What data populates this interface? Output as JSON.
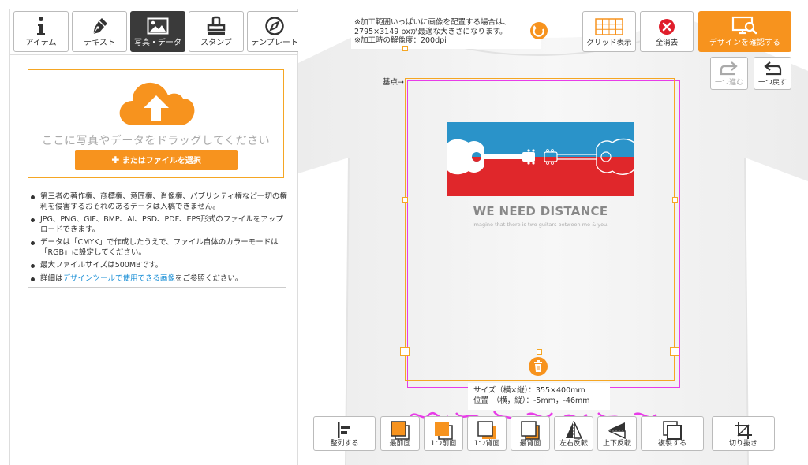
{
  "tabs": [
    {
      "label": "アイテム",
      "icon": "info-icon"
    },
    {
      "label": "テキスト",
      "icon": "pen-icon"
    },
    {
      "label": "写真・データ",
      "icon": "image-icon",
      "active": true
    },
    {
      "label": "スタンプ",
      "icon": "stamp-icon"
    },
    {
      "label": "テンプレート",
      "icon": "compass-icon"
    }
  ],
  "upload": {
    "drop_text": "ここに写真やデータをドラッグしてください",
    "select_button": "またはファイルを選択",
    "button_icon": "plus-icon"
  },
  "notes": [
    "第三者の著作権、商標権、意匠権、肖像権、パブリシティ権など一切の権利を侵害するおそれのあるデータは入稿できません。",
    "JPG、PNG、GIF、BMP、AI、PSD、PDF、EPS形式のファイルをアップロードできます。",
    "データは「CMYK」で作成したうえで、ファイル自体のカラーモードは「RGB」に設定してください。",
    "最大ファイルサイズは500MBです。"
  ],
  "note_last": {
    "prefix": "詳細は",
    "link": "デザインツールで使用できる画像",
    "suffix": "をご参照ください。"
  },
  "canvas": {
    "info_lines": [
      "※加工範囲いっぱいに画像を配置する場合は、",
      "2795×3149 pxが最適な大きさになります。",
      "※加工時の解像度：200dpi"
    ],
    "base_point_label": "基点→",
    "design_title": "WE NEED DISTANCE",
    "design_subtitle": "Imagine that there is two guitars between me & you.",
    "size_line": "サイズ（横×縦）：355×400mm",
    "position_line": "位置　（横，縦）：-5mm，-46mm",
    "colors": {
      "band_blue": "#2a93c9",
      "band_red": "#e0272b",
      "accent": "#f7931e",
      "print_area": "#e83ce8"
    }
  },
  "top_buttons": {
    "grid": "グリッド表示",
    "clear_all": "全消去",
    "check_design": "デザインを確認する",
    "redo": "一つ進む",
    "undo": "一つ戻す"
  },
  "bottom_toolbar": [
    {
      "label": "整列する",
      "icon": "align-left-icon"
    },
    {
      "label": "最前面",
      "icon": "bring-to-front-icon"
    },
    {
      "label": "1つ前面",
      "icon": "bring-forward-icon"
    },
    {
      "label": "1つ背面",
      "icon": "send-backward-icon"
    },
    {
      "label": "最背面",
      "icon": "send-to-back-icon"
    },
    {
      "label": "左右反転",
      "icon": "flip-horizontal-icon"
    },
    {
      "label": "上下反転",
      "icon": "flip-vertical-icon"
    },
    {
      "label": "複製する",
      "icon": "duplicate-icon"
    },
    {
      "label": "切り抜き",
      "icon": "crop-icon"
    }
  ]
}
